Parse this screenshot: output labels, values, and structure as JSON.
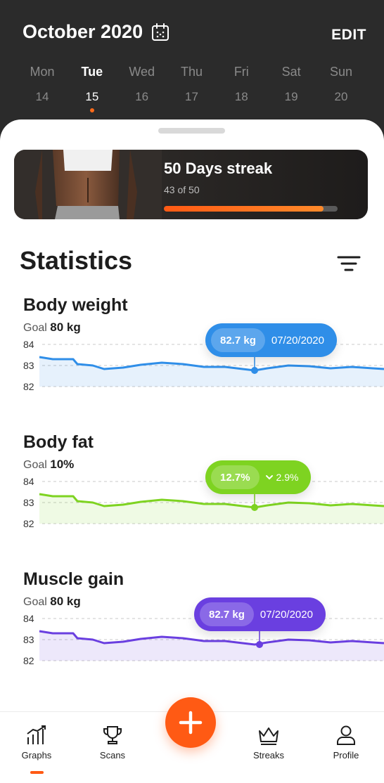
{
  "header": {
    "month_title": "October 2020",
    "edit_label": "EDIT",
    "days": [
      {
        "name": "Mon",
        "date": "14"
      },
      {
        "name": "Tue",
        "date": "15"
      },
      {
        "name": "Wed",
        "date": "16"
      },
      {
        "name": "Thu",
        "date": "17"
      },
      {
        "name": "Fri",
        "date": "18"
      },
      {
        "name": "Sat",
        "date": "19"
      },
      {
        "name": "Sun",
        "date": "20"
      }
    ],
    "selected_day": "Tue"
  },
  "streak": {
    "title": "50 Days streak",
    "subtitle": "43 of 50",
    "progress": 0.92
  },
  "statistics": {
    "title": "Statistics"
  },
  "metrics": [
    {
      "title": "Body weight",
      "goal_label": "Goal",
      "goal_value": "80 kg",
      "y_ticks": [
        "84",
        "83",
        "82"
      ],
      "color": "#2f8ee8",
      "tooltip_value": "82.7 kg",
      "tooltip_extra": "07/20/2020"
    },
    {
      "title": "Body fat",
      "goal_label": "Goal",
      "goal_value": "10%",
      "y_ticks": [
        "84",
        "83",
        "82"
      ],
      "color": "#7ed321",
      "tooltip_value": "12.7%",
      "tooltip_extra": "2.9%"
    },
    {
      "title": "Muscle gain",
      "goal_label": "Goal",
      "goal_value": "80 kg",
      "y_ticks": [
        "84",
        "83",
        "82"
      ],
      "color": "#6a3fe0",
      "tooltip_value": "82.7 kg",
      "tooltip_extra": "07/20/2020"
    }
  ],
  "nav": {
    "items": [
      {
        "label": "Graphs",
        "icon": "bar-chart-icon"
      },
      {
        "label": "Scans",
        "icon": "trophy-icon"
      },
      {
        "label": "Streaks",
        "icon": "crown-icon"
      },
      {
        "label": "Profile",
        "icon": "user-icon"
      }
    ],
    "active": "Graphs",
    "fab_icon": "plus-icon"
  },
  "colors": {
    "accent": "#ff5a14",
    "header_bg": "#2b2b2b"
  }
}
